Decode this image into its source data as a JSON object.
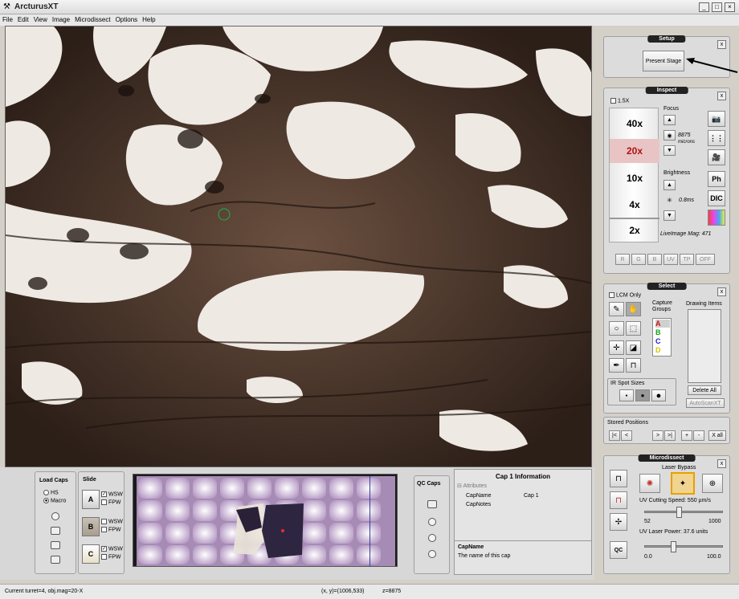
{
  "app": {
    "title": "ArcturusXT"
  },
  "menu": [
    "File",
    "Edit",
    "View",
    "Image",
    "Microdissect",
    "Options",
    "Help"
  ],
  "window_buttons": [
    "_",
    "□",
    "×"
  ],
  "setup": {
    "title": "Setup",
    "close": "x",
    "present_stage": "Present Stage"
  },
  "inspect": {
    "title": "Inspect",
    "close": "x",
    "opt_15x": "1.5X",
    "mags": [
      "40x",
      "20x",
      "10x",
      "4x",
      "2x"
    ],
    "selected_mag": "20x",
    "focus_label": "Focus",
    "focus_value": "8875",
    "focus_unit": "microns",
    "brightness_label": "Brightness",
    "brightness_value": "0.8ms",
    "liveimage": "LiveImage Mag: 471",
    "side_buttons": [
      "Ph",
      "DIC"
    ],
    "filters": [
      "R",
      "G",
      "B",
      "UV",
      "TP",
      "OFF"
    ]
  },
  "select": {
    "title": "Select",
    "close": "x",
    "lcm_only": "LCM Only",
    "capture_groups_label": "Capture Groups",
    "groups": [
      {
        "letter": "A",
        "color": "#d01010"
      },
      {
        "letter": "B",
        "color": "#14a014"
      },
      {
        "letter": "C",
        "color": "#1818c8"
      },
      {
        "letter": "D",
        "color": "#d8c400"
      }
    ],
    "drawing_items_label": "Drawing Items",
    "ir_spot_sizes": "IR Spot Sizes",
    "delete_all": "Delete All",
    "autoscan": "AutoScanXT"
  },
  "stored": {
    "label": "Stored Positions",
    "buttons": [
      "|<",
      "<",
      ">",
      ">|",
      "+",
      "-",
      "X all"
    ]
  },
  "microdissect": {
    "title": "Microdissect",
    "close": "x",
    "laser_bypass": "Laser Bypass",
    "uv_speed": "UV Cutting Speed: 550 µm/s",
    "speed_min": "52",
    "speed_max": "1000",
    "speed_level": 0.45,
    "uv_power": "UV Laser Power: 37.6 units",
    "power_min": "0.0",
    "power_max": "100.0",
    "power_level": 0.38,
    "qc": "QC"
  },
  "load_caps": {
    "title": "Load Caps",
    "options": [
      "HS",
      "Macro"
    ],
    "selected": "Macro"
  },
  "slide": {
    "title": "Slide",
    "slots": [
      {
        "letter": "A",
        "wsw": "WSW",
        "fpw": "FPW",
        "wsw_checked": true
      },
      {
        "letter": "B",
        "wsw": "WSW",
        "fpw": "FPW",
        "wsw_checked": false
      },
      {
        "letter": "C",
        "wsw": "WSW",
        "fpw": "FPW",
        "wsw_checked": true
      }
    ]
  },
  "qc_caps": {
    "title": "QC Caps"
  },
  "cap_info": {
    "title": "Cap 1 Information",
    "tree_root": "Attributes",
    "rows": [
      {
        "key": "CapName",
        "value": "Cap 1"
      },
      {
        "key": "CapNotes",
        "value": ""
      }
    ],
    "desc_title": "CapName",
    "desc_text": "The name of this cap"
  },
  "status": {
    "turret": "Current turret=4, obj.mag=20-X",
    "xy": "(x, y)=(1006,533)",
    "z": "z=8875"
  }
}
